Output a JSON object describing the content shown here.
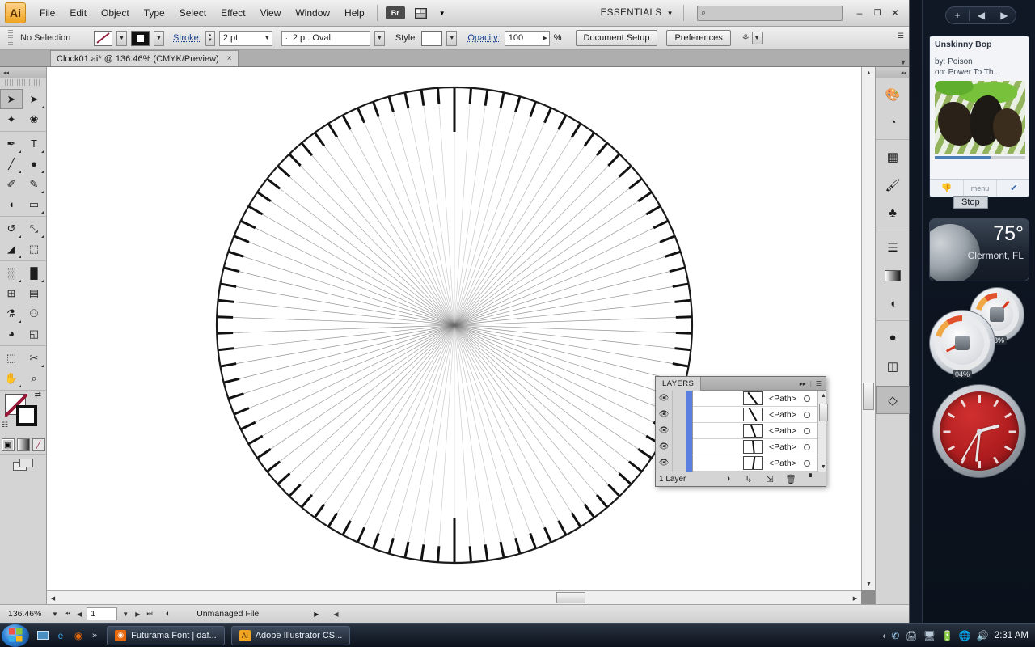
{
  "app": {
    "logo_text": "Ai",
    "menus": [
      "File",
      "Edit",
      "Object",
      "Type",
      "Select",
      "Effect",
      "View",
      "Window",
      "Help"
    ],
    "bridge_label": "Br",
    "arrange_icon": "arrange-documents-icon",
    "workspace": "ESSENTIALS",
    "search_placeholder": "",
    "window_minimize": "–",
    "window_restore": "❐",
    "window_close": "✕"
  },
  "control_bar": {
    "selection_state": "No Selection",
    "stroke_label": "Stroke:",
    "stroke_weight": "2 pt",
    "brush_def": "2 pt. Oval",
    "style_label": "Style:",
    "opacity_label": "Opacity:",
    "opacity_value": "100",
    "percent": "%",
    "document_setup": "Document Setup",
    "preferences": "Preferences"
  },
  "tab": {
    "title": "Clock01.ai* @ 136.46% (CMYK/Preview)",
    "close": "×"
  },
  "tools": {
    "groups": [
      [
        {
          "name": "selection-tool",
          "glyph": "➤",
          "selected": true,
          "corner": false
        },
        {
          "name": "direct-selection-tool",
          "glyph": "➤",
          "selected": false,
          "corner": true
        },
        {
          "name": "magic-wand-tool",
          "glyph": "✦",
          "selected": false,
          "corner": false
        },
        {
          "name": "lasso-tool",
          "glyph": "❀",
          "selected": false,
          "corner": false
        }
      ],
      [
        {
          "name": "pen-tool",
          "glyph": "✒",
          "selected": false,
          "corner": true
        },
        {
          "name": "type-tool",
          "glyph": "T",
          "selected": false,
          "corner": true
        },
        {
          "name": "line-segment-tool",
          "glyph": "╱",
          "selected": false,
          "corner": true
        },
        {
          "name": "ellipse-tool",
          "glyph": "●",
          "selected": false,
          "corner": true
        },
        {
          "name": "paintbrush-tool",
          "glyph": "✐",
          "selected": false,
          "corner": false
        },
        {
          "name": "pencil-tool",
          "glyph": "✎",
          "selected": false,
          "corner": true
        },
        {
          "name": "blob-brush-tool",
          "glyph": "◖",
          "selected": false,
          "corner": false
        },
        {
          "name": "eraser-tool",
          "glyph": "▭",
          "selected": false,
          "corner": true
        }
      ],
      [
        {
          "name": "rotate-tool",
          "glyph": "↺",
          "selected": false,
          "corner": true
        },
        {
          "name": "scale-tool",
          "glyph": "⤡",
          "selected": false,
          "corner": true
        },
        {
          "name": "width-warp-tool",
          "glyph": "◢",
          "selected": false,
          "corner": true
        },
        {
          "name": "free-transform-tool",
          "glyph": "⬚",
          "selected": false,
          "corner": false
        }
      ],
      [
        {
          "name": "symbol-sprayer-tool",
          "glyph": "░",
          "selected": false,
          "corner": true
        },
        {
          "name": "column-graph-tool",
          "glyph": "█",
          "selected": false,
          "corner": true
        },
        {
          "name": "mesh-tool",
          "glyph": "⊞",
          "selected": false,
          "corner": false
        },
        {
          "name": "gradient-tool",
          "glyph": "▤",
          "selected": false,
          "corner": false
        },
        {
          "name": "eyedropper-tool",
          "glyph": "⚗",
          "selected": false,
          "corner": true
        },
        {
          "name": "blend-tool",
          "glyph": "⚇",
          "selected": false,
          "corner": false
        },
        {
          "name": "live-paint-bucket-tool",
          "glyph": "◕",
          "selected": false,
          "corner": false
        },
        {
          "name": "live-paint-selection-tool",
          "glyph": "◱",
          "selected": false,
          "corner": false
        }
      ],
      [
        {
          "name": "artboard-tool",
          "glyph": "⬚",
          "selected": false,
          "corner": false
        },
        {
          "name": "slice-tool",
          "glyph": "✂",
          "selected": false,
          "corner": true
        },
        {
          "name": "hand-tool",
          "glyph": "✋",
          "selected": false,
          "corner": true
        },
        {
          "name": "zoom-tool",
          "glyph": "⌕",
          "selected": false,
          "corner": false
        }
      ]
    ],
    "fill_swatch_name": "fill-color-swatch",
    "stroke_swatch_name": "stroke-color-swatch",
    "swap_icon": "swap-fill-stroke-icon",
    "default_icon": "default-fill-stroke-icon",
    "paint_modes": [
      "color-mode-icon",
      "gradient-mode-icon",
      "none-mode-icon"
    ],
    "screen_mode": "change-screen-mode-icon"
  },
  "right_dock": {
    "collapse_icon": "expand-panels-icon",
    "groups": [
      [
        "color-panel-icon",
        "color-guide-panel-icon"
      ],
      [
        "swatches-panel-icon",
        "brushes-panel-icon",
        "symbols-panel-icon"
      ],
      [
        "stroke-panel-icon",
        "gradient-panel-icon",
        "transparency-panel-icon"
      ],
      [
        "appearance-panel-icon",
        "graphic-styles-panel-icon"
      ],
      [
        "layers-panel-icon"
      ]
    ]
  },
  "layers_panel": {
    "tab_label": "LAYERS",
    "collapse_icon": "collapse-to-icons-icon",
    "menu_icon": "panel-menu-icon",
    "rows": [
      {
        "name": "<Path>",
        "thumb_angle": -38,
        "visible": true
      },
      {
        "name": "<Path>",
        "thumb_angle": -30,
        "visible": true
      },
      {
        "name": "<Path>",
        "thumb_angle": -20,
        "visible": true
      },
      {
        "name": "<Path>",
        "thumb_angle": -6,
        "visible": true
      },
      {
        "name": "<Path>",
        "thumb_angle": 8,
        "visible": true
      }
    ],
    "footer_count": "1 Layer",
    "footer_icons": [
      "make-clipping-mask-icon",
      "create-new-sublayer-icon",
      "create-new-layer-icon",
      "delete-selection-icon"
    ]
  },
  "status_bar": {
    "zoom": "136.46%",
    "first_page_icon": "⏮",
    "prev_page_icon": "◀",
    "page": "1",
    "next_page_icon": "▶",
    "last_page_icon": "⏭",
    "status_icon": "status-menu-icon",
    "status_text": "Unmanaged File",
    "status_caret": "▶"
  },
  "artwork": {
    "name": "clock-dial-artwork",
    "radial_lines": 90,
    "major_ticks": 90,
    "circle_stroke": "#1a1a1a"
  },
  "gadgets": {
    "header": {
      "add": "+",
      "prev": "◀",
      "next": "▶"
    },
    "media": {
      "track_title": "Unskinny Bop",
      "by_label": "by: Poison",
      "on_label": "on: Power To Th...",
      "progress_percent": 62,
      "thumbs_down_icon": "thumbs-down-icon",
      "menu_label": "menu",
      "check_icon": "check-icon",
      "stop_button": "Stop"
    },
    "weather": {
      "temperature": "75°",
      "location": "Clermont, FL",
      "condition_icon": "moon-icon"
    },
    "gauges": [
      {
        "name": "cpu-gauge",
        "label": "48%",
        "needle_deg": 42
      },
      {
        "name": "memory-gauge",
        "label": "04%",
        "needle_deg": -118
      }
    ],
    "clock": {
      "name": "analog-clock-gadget",
      "hour_deg": 75,
      "minute_deg": 186,
      "second_deg": 210
    }
  },
  "taskbar": {
    "start_icon": "windows-start-icon",
    "quick_launch": [
      "show-desktop-icon",
      "internet-explorer-icon",
      "firefox-icon"
    ],
    "more_icon": "»",
    "tasks": [
      {
        "label": "Futurama Font | daf...",
        "icon": "firefox-icon",
        "icon_glyph": "◉",
        "icon_bg": "#e8690b"
      },
      {
        "label": "Adobe Illustrator CS...",
        "icon": "illustrator-icon",
        "icon_glyph": "Ai",
        "icon_bg": "#f0a422"
      }
    ],
    "tray_icons": [
      "show-hidden-icons-icon",
      "network-phone-icon",
      "printer-icon",
      "display-icon",
      "battery-icon",
      "network-icon",
      "volume-icon"
    ],
    "clock": "2:31 AM"
  }
}
